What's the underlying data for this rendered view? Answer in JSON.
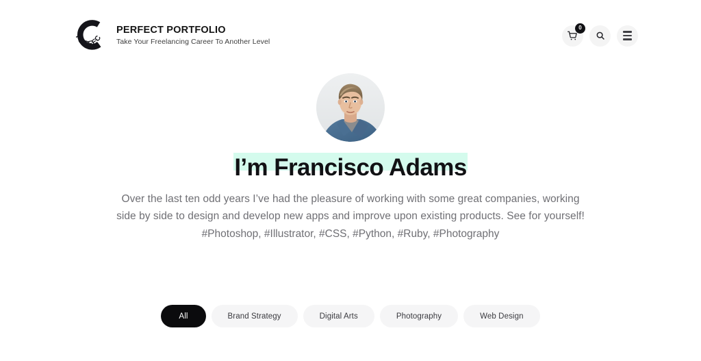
{
  "header": {
    "logo": {
      "icon": "perfect-circular-logo",
      "ring_text": "PERFECT"
    },
    "brand_title": "PERFECT PORTFOLIO",
    "brand_tagline": "Take Your Freelancing Career To Another Level",
    "actions": {
      "cart": {
        "icon": "shopping-cart-icon",
        "badge_count": "0"
      },
      "search": {
        "icon": "search-icon"
      },
      "menu": {
        "icon": "hamburger-menu-icon"
      }
    }
  },
  "hero": {
    "avatar_alt": "profile-photo",
    "title": "I’m Francisco Adams",
    "description": "Over the last ten odd years I’ve had the pleasure of working with some great companies, working side by side to design and develop new apps and improve upon existing products. See for yourself!",
    "tags": "#Photoshop, #Illustrator, #CSS, #Python, #Ruby, #Photography"
  },
  "filters": [
    {
      "label": "All",
      "active": true
    },
    {
      "label": "Brand Strategy",
      "active": false
    },
    {
      "label": "Digital Arts",
      "active": false
    },
    {
      "label": "Photography",
      "active": false
    },
    {
      "label": "Web Design",
      "active": false
    }
  ],
  "colors": {
    "page_background": "#ffffff",
    "accent_highlight": "#d4fbed",
    "active_pill": "#0b0b0d",
    "pill_background": "#f5f5f6",
    "icon_button_background": "#f4f4f4",
    "body_text": "#6f6f74",
    "heading_text": "#111114"
  }
}
